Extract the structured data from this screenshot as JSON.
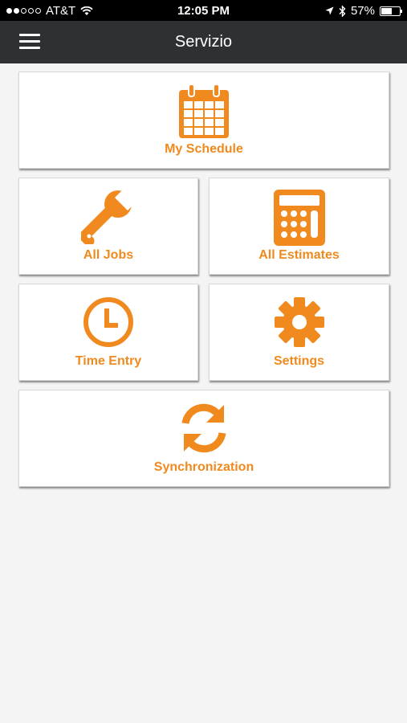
{
  "status_bar": {
    "carrier": "AT&T",
    "time": "12:05 PM",
    "battery_percent": "57%",
    "battery_level": 0.57,
    "signal_bars_filled": 2,
    "signal_bars_total": 5
  },
  "header": {
    "title": "Servizio",
    "menu_icon": "hamburger-menu-icon"
  },
  "accent_color": "#f08a1e",
  "tiles": [
    {
      "label": "My Schedule",
      "icon": "calendar-icon"
    },
    {
      "label": "All Jobs",
      "icon": "wrench-icon"
    },
    {
      "label": "All Estimates",
      "icon": "calculator-icon"
    },
    {
      "label": "Time Entry",
      "icon": "clock-icon"
    },
    {
      "label": "Settings",
      "icon": "gear-icon"
    },
    {
      "label": "Synchronization",
      "icon": "sync-icon"
    }
  ]
}
